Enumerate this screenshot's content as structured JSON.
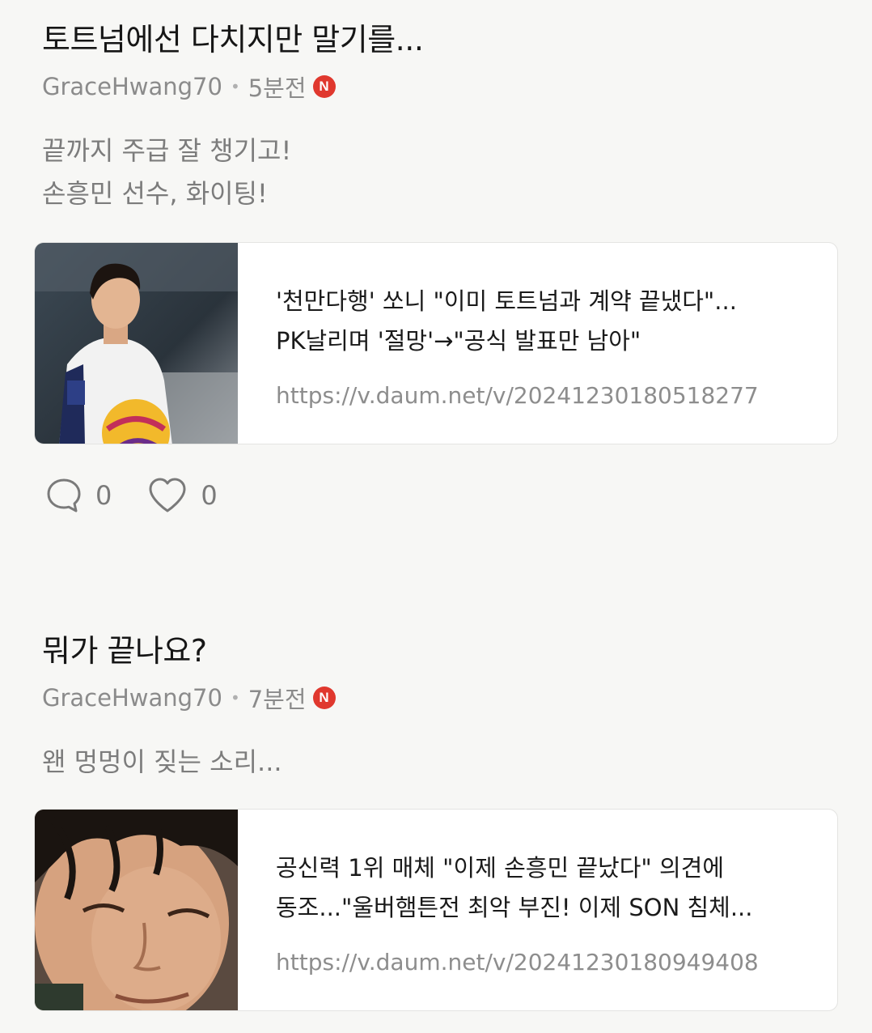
{
  "posts": [
    {
      "title": "토트넘에선 다치지만 말기를...",
      "author": "GraceHwang70",
      "time": "5분전",
      "new_badge": "N",
      "body_lines": [
        "끝까지 주급 잘 챙기고!",
        "손흥민 선수, 화이팅!"
      ],
      "link_card": {
        "title_lines": [
          "'천만다행' 쏘니 \"이미 토트넘과 계약 끝냈다\"...",
          "PK날리며 '절망'→\"공식 발표만 남아\""
        ],
        "url": "https://v.daum.net/v/20241230180518277",
        "thumbnail": "soccer-player-with-ball-photo"
      },
      "comments": "0",
      "likes": "0"
    },
    {
      "title": "뭐가 끝나요?",
      "author": "GraceHwang70",
      "time": "7분전",
      "new_badge": "N",
      "body_lines": [
        "왠 멍멍이 짖는 소리..."
      ],
      "link_card": {
        "title_lines": [
          "공신력 1위 매체 \"이제 손흥민 끝났다\" 의견에",
          "동조...\"울버햄튼전 최악 부진! 이제 SON 침체..."
        ],
        "url": "https://v.daum.net/v/20241230180949408",
        "thumbnail": "player-face-closeup-photo"
      }
    }
  ],
  "colors": {
    "accent_badge": "#e0382e",
    "meta_text": "#8b8b8b",
    "body_text": "#7c7c7c"
  }
}
